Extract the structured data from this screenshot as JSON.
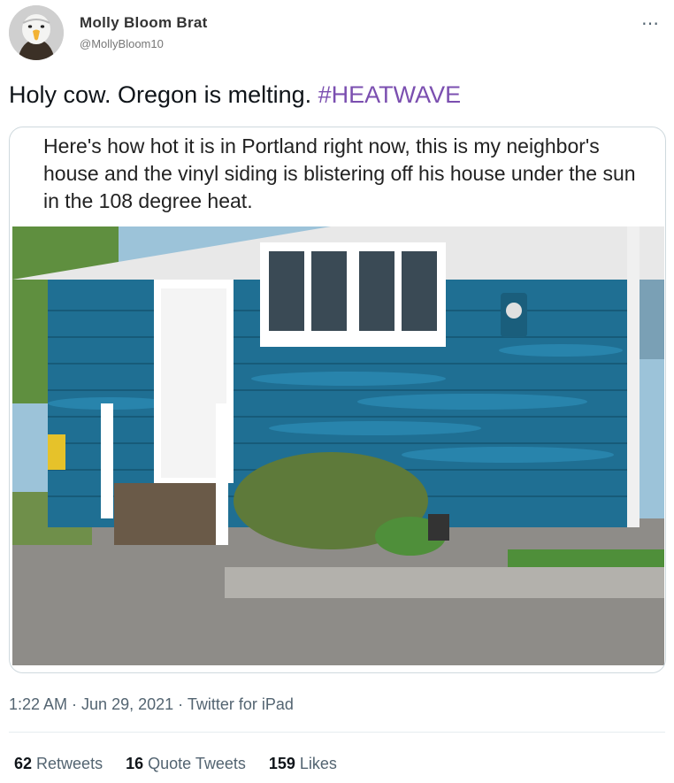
{
  "author": {
    "name": "Molly Bloom Brat",
    "handle": "@MollyBloom10"
  },
  "more_icon": "⋯",
  "tweet": {
    "text": "Holy cow. Oregon is melting. ",
    "hashtag": "#HEATWAVE"
  },
  "media": {
    "caption": "Here's how hot it is in Portland right now, this is my neighbor's house and the vinyl siding is blistering off his house under the sun in the 108 degree heat."
  },
  "meta": {
    "time": "1:22 AM",
    "date": "Jun 29, 2021",
    "source": "Twitter for iPad",
    "separator": " · "
  },
  "stats": {
    "retweets_count": "62",
    "retweets_label": "Retweets",
    "quotes_count": "16",
    "quotes_label": "Quote Tweets",
    "likes_count": "159",
    "likes_label": "Likes"
  },
  "colors": {
    "hashtag": "#7b4fb0",
    "siding": "#1f6f93",
    "trim": "#ffffff"
  }
}
